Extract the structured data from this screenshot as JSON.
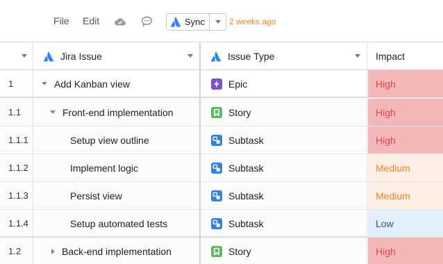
{
  "toolbar": {
    "menu": [
      "File",
      "Edit"
    ],
    "cloud_icon": "cloud-icon",
    "comment_icon": "comment-icon",
    "sync_label": "Sync",
    "updated_text": "2 weeks ago"
  },
  "columns": {
    "jira_issue": "Jira Issue",
    "issue_type": "Issue Type",
    "impact": "Impact"
  },
  "rows": [
    {
      "id": "1",
      "issue": "Add Kanban view",
      "type": "Epic",
      "impact": "High"
    },
    {
      "id": "1.1",
      "issue": "Front-end implementation",
      "type": "Story",
      "impact": "High"
    },
    {
      "id": "1.1.1",
      "issue": "Setup view outline",
      "type": "Subtask",
      "impact": "High"
    },
    {
      "id": "1.1.2",
      "issue": "Implement logic",
      "type": "Subtask",
      "impact": "Medium"
    },
    {
      "id": "1.1.3",
      "issue": "Persist view",
      "type": "Subtask",
      "impact": "Medium"
    },
    {
      "id": "1.1.4",
      "issue": "Setup automated tests",
      "type": "Subtask",
      "impact": "Low"
    },
    {
      "id": "1.2",
      "issue": "Back-end implementation",
      "type": "Story",
      "impact": "High"
    }
  ],
  "colors": {
    "jira_blue": "#2684ff",
    "epic": "#7e4fd5",
    "story": "#5fb761",
    "subtask": "#2d83e6",
    "high_bg": "#f5b8b8",
    "high_text": "#e0474b",
    "medium_bg": "#fdeee6",
    "medium_text": "#f0851d",
    "low_bg": "#e3eefb",
    "low_text": "#2a5b9b",
    "updated_text": "#f0851d"
  }
}
